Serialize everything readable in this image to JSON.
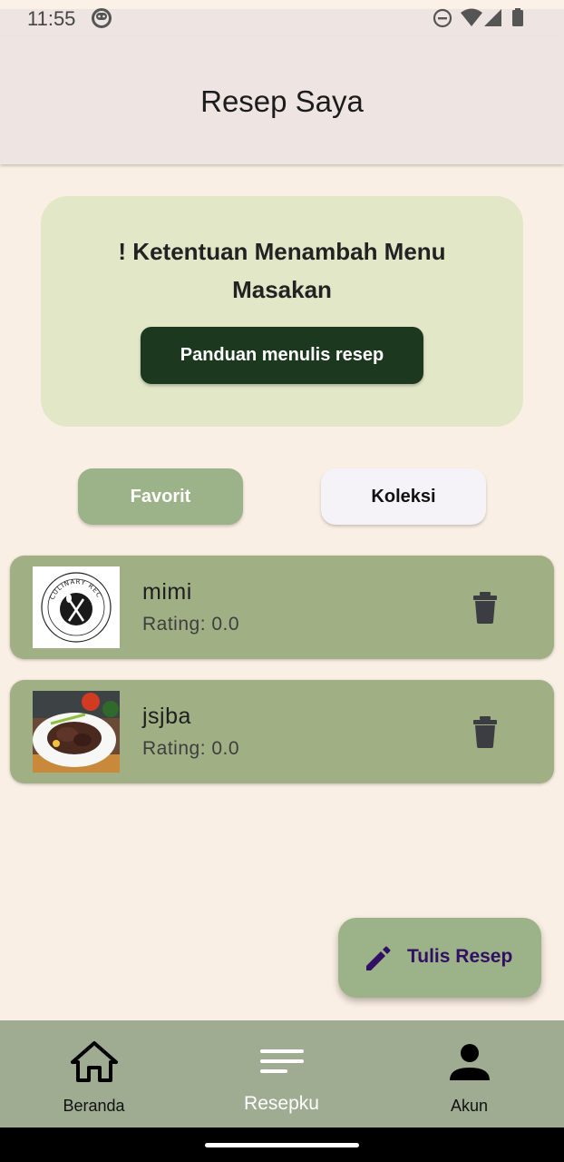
{
  "status_bar": {
    "time": "11:55",
    "icons": [
      "android-robot-icon",
      "do-not-disturb-icon",
      "wifi-icon",
      "cellular-signal-icon",
      "battery-icon"
    ]
  },
  "app_bar": {
    "title": "Resep Saya"
  },
  "info_card": {
    "title": "! Ketentuan Menambah Menu Masakan",
    "button_label": "Panduan menulis resep"
  },
  "toggles": {
    "favorit": "Favorit",
    "koleksi": "Koleksi",
    "active": "Favorit"
  },
  "recipes": [
    {
      "name": "mimi",
      "rating": "Rating: 0.0",
      "thumbnail": "culinary-logo",
      "thumbnail_text": "CULINARY REC"
    },
    {
      "name": "jsjba",
      "rating": "Rating: 0.0",
      "thumbnail": "food-photo"
    }
  ],
  "fab": {
    "label": "Tulis Resep",
    "icon": "pencil-icon"
  },
  "bottom_nav": {
    "items": [
      {
        "label": "Beranda",
        "icon": "home-icon"
      },
      {
        "label": "Resepku",
        "icon": "list-icon"
      },
      {
        "label": "Akun",
        "icon": "person-icon"
      }
    ],
    "active": "Resepku"
  },
  "colors": {
    "background": "#faefe4",
    "app_bar": "#eee5e2",
    "info_card": "#e2e7c7",
    "primary_dark": "#1c3920",
    "accent_green": "#9cb288",
    "card_green": "#a1b084",
    "nav_bg": "#9fac92"
  }
}
